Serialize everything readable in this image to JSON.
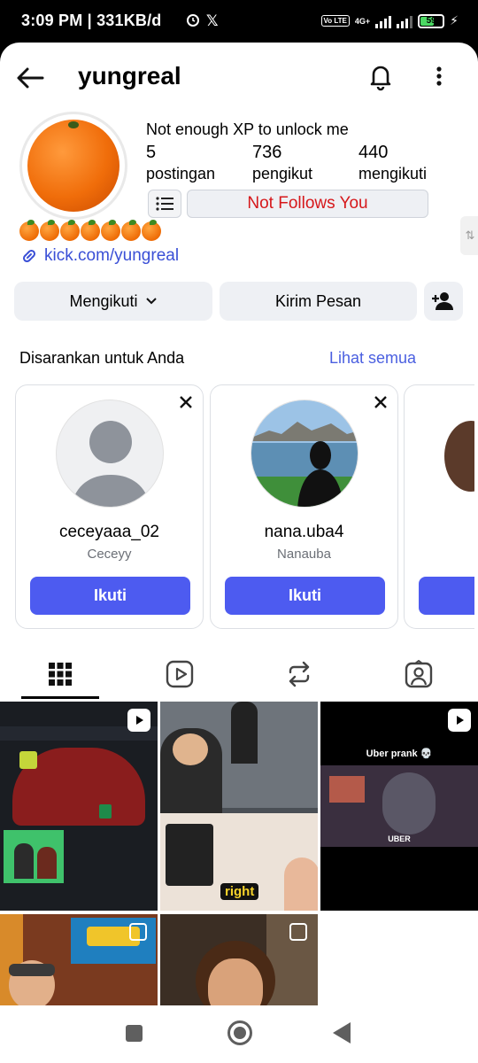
{
  "status_bar": {
    "time": "3:09 PM | 331KB/d",
    "battery": "59",
    "network": "4G+",
    "volte": "Vo LTE"
  },
  "header": {
    "username": "yungreal"
  },
  "profile": {
    "display_name": "Not enough XP to unlock me",
    "stats": [
      {
        "value": "5",
        "label": "postingan"
      },
      {
        "value": "736",
        "label": "pengikut"
      },
      {
        "value": "440",
        "label": "mengikuti"
      }
    ],
    "follow_status": "Not Follows You",
    "emoji_count": 7,
    "link": "kick.com/yungreal"
  },
  "actions": {
    "following": "Mengikuti",
    "message": "Kirim Pesan"
  },
  "suggestions": {
    "title": "Disarankan untuk Anda",
    "see_all": "Lihat semua",
    "cards": [
      {
        "username": "ceceyaaa_02",
        "name": "Ceceyy",
        "button": "Ikuti"
      },
      {
        "username": "nana.uba4",
        "name": "Nanauba",
        "button": "Ikuti"
      }
    ]
  },
  "posts": {
    "captions": [
      "right",
      "Uber prank 💀",
      "UBER"
    ]
  },
  "colors": {
    "accent_blue": "#4d5bf0",
    "link_blue": "#3a4fd6",
    "alert_red": "#d6181b"
  }
}
